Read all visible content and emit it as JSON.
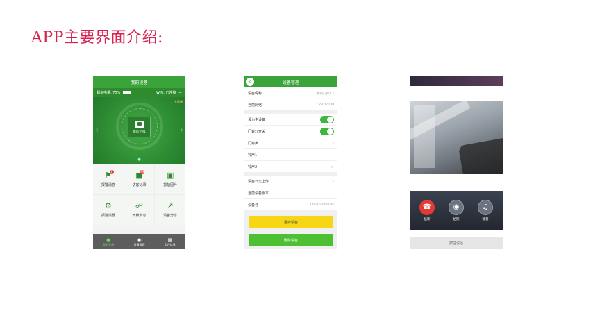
{
  "slide": {
    "title": "APP主要界面介绍:"
  },
  "phone1": {
    "header_title": "我的设备",
    "battery_text": "剩余电量: 75%",
    "wifi_text": "WiFi: 已连接",
    "more_badge": "全设备",
    "device_name": "我家门铃1",
    "grid": [
      {
        "label": "报警消息",
        "icon": "alarm-icon",
        "badge": "2"
      },
      {
        "label": "访客记录",
        "icon": "visitor-record-icon",
        "badge": "99"
      },
      {
        "label": "抓拍图片",
        "icon": "picture-icon",
        "badge": ""
      },
      {
        "label": "报警设置",
        "icon": "gear-icon",
        "badge": ""
      },
      {
        "label": "开锁消息",
        "icon": "unlock-icon",
        "badge": ""
      },
      {
        "label": "设备分享",
        "icon": "share-icon",
        "badge": ""
      }
    ],
    "tabs": [
      {
        "label": "我的设备",
        "icon": "person-icon",
        "active": true
      },
      {
        "label": "设备管理",
        "icon": "device-manage-icon",
        "active": false
      },
      {
        "label": "用户信息",
        "icon": "grid-icon",
        "active": false
      }
    ],
    "colors": {
      "primary": "#3aa33a",
      "tabbar": "#5d5d5d",
      "badge": "#e53935"
    }
  },
  "phone2": {
    "header_title": "设备管理",
    "rows": {
      "device_name_label": "设备昵称",
      "device_name_value": "我家门铃1",
      "network_label": "当前网络",
      "network_value": "SSID:COM",
      "main_device_label": "设为主设备",
      "door_light_label": "门铃灯开关",
      "ringtone_label": "门铃声",
      "ring1_label": "铃声1",
      "ring2_label": "铃声2",
      "log_upload_label": "设备日志上传",
      "version_label": "当前设备版本",
      "device_id_label": "设备号",
      "device_id_value": "0063c40011d5"
    },
    "restart_button": "重启设备",
    "delete_button": "删除设备",
    "colors": {
      "restart": "#f7d715",
      "delete": "#4cc032",
      "toggle_on": "#3cb83c"
    }
  },
  "phone3": {
    "controls": [
      {
        "label": "挂断",
        "icon": "hang-up-icon"
      },
      {
        "label": "拍照",
        "icon": "camera-icon"
      },
      {
        "label": "静音",
        "icon": "speaker-icon"
      }
    ],
    "footer_text": "按住说话",
    "colors": {
      "hangup": "#e53935"
    }
  }
}
